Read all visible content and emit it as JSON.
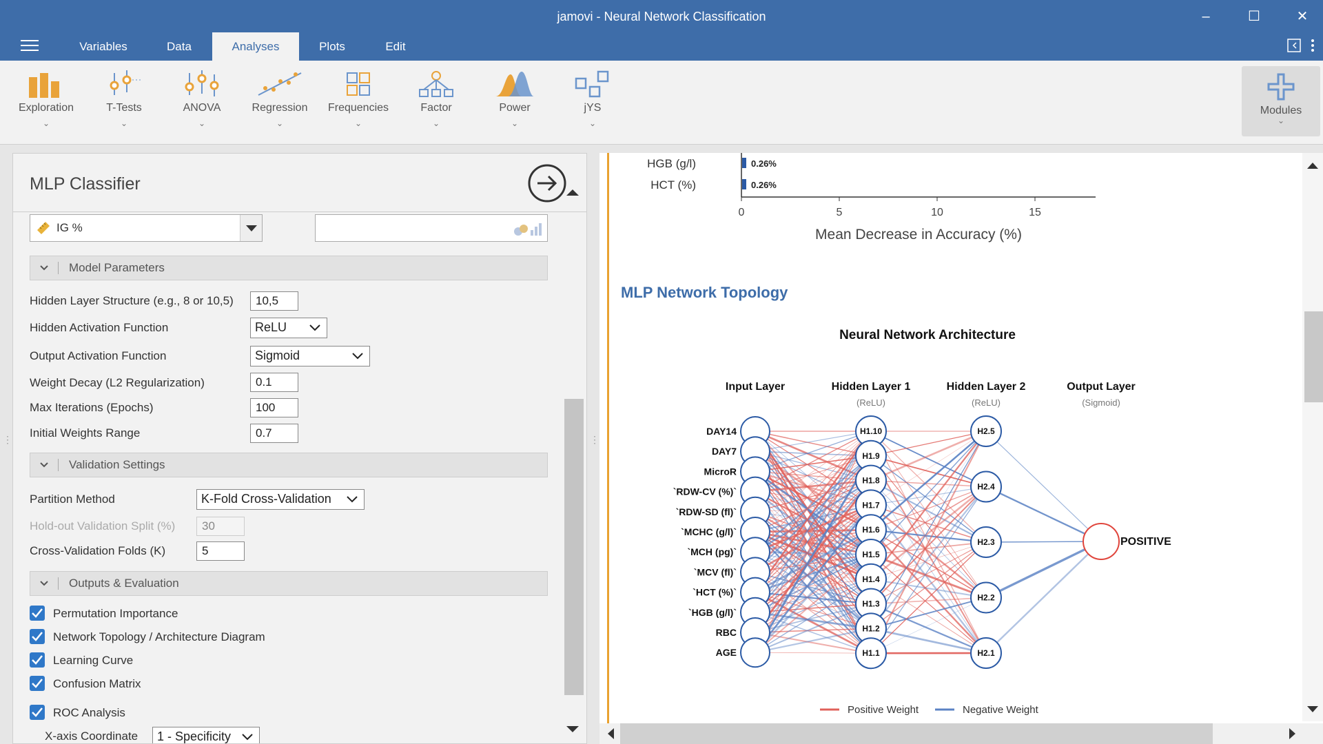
{
  "window": {
    "title": "jamovi - Neural Network Classification"
  },
  "menu": {
    "tabs": [
      "Variables",
      "Data",
      "Analyses",
      "Plots",
      "Edit"
    ],
    "active": "Analyses"
  },
  "ribbon": {
    "items": [
      "Exploration",
      "T-Tests",
      "ANOVA",
      "Regression",
      "Frequencies",
      "Factor",
      "Power",
      "jYS"
    ],
    "modules": "Modules"
  },
  "panel": {
    "title": "MLP Classifier",
    "target_variable": "IG %",
    "sections": {
      "model": "Model Parameters",
      "validation": "Validation Settings",
      "outputs": "Outputs & Evaluation"
    },
    "model": {
      "hidden_structure_label": "Hidden Layer Structure (e.g., 8 or 10,5)",
      "hidden_structure_value": "10,5",
      "hidden_activation_label": "Hidden Activation Function",
      "hidden_activation_value": "ReLU",
      "output_activation_label": "Output Activation Function",
      "output_activation_value": "Sigmoid",
      "weight_decay_label": "Weight Decay (L2 Regularization)",
      "weight_decay_value": "0.1",
      "max_iter_label": "Max Iterations (Epochs)",
      "max_iter_value": "100",
      "init_weights_label": "Initial Weights Range",
      "init_weights_value": "0.7"
    },
    "validation": {
      "partition_label": "Partition Method",
      "partition_value": "K-Fold Cross-Validation",
      "holdout_label": "Hold-out Validation Split (%)",
      "holdout_value": "30",
      "folds_label": "Cross-Validation Folds (K)",
      "folds_value": "5"
    },
    "outputs": {
      "checks": [
        "Permutation Importance",
        "Network Topology / Architecture Diagram",
        "Learning Curve",
        "Confusion Matrix",
        "ROC Analysis"
      ],
      "xaxis_label": "X-axis Coordinate",
      "xaxis_value": "1 - Specificity"
    }
  },
  "importance": {
    "rows": [
      {
        "name": "HGB (g/l)",
        "value": "0.26%"
      },
      {
        "name": "HCT (%)",
        "value": "0.26%"
      }
    ],
    "ticks": [
      "0",
      "5",
      "10",
      "15"
    ],
    "xlabel": "Mean Decrease in Accuracy (%)"
  },
  "results": {
    "heading": "MLP Network Topology"
  },
  "chart_data": {
    "type": "diagram",
    "title": "Neural Network Architecture",
    "layers": [
      {
        "name": "Input Layer",
        "sub": "",
        "nodes": [
          "DAY14",
          "DAY7",
          "MicroR",
          "`RDW-CV (%)`",
          "`RDW-SD (fl)`",
          "`MCHC (g/l)`",
          "`MCH (pg)`",
          "`MCV (fl)`",
          "`HCT (%)`",
          "`HGB (g/l)`",
          "RBC",
          "AGE"
        ]
      },
      {
        "name": "Hidden Layer 1",
        "sub": "(ReLU)",
        "nodes": [
          "H1.10",
          "H1.9",
          "H1.8",
          "H1.7",
          "H1.6",
          "H1.5",
          "H1.4",
          "H1.3",
          "H1.2",
          "H1.1"
        ]
      },
      {
        "name": "Hidden Layer 2",
        "sub": "(ReLU)",
        "nodes": [
          "H2.5",
          "H2.4",
          "H2.3",
          "H2.2",
          "H2.1"
        ]
      },
      {
        "name": "Output Layer",
        "sub": "(Sigmoid)",
        "nodes": [
          "POSITIVE"
        ]
      }
    ],
    "legend": [
      {
        "name": "Positive Weight",
        "color": "#e0605a"
      },
      {
        "name": "Negative Weight",
        "color": "#5b82c4"
      }
    ]
  }
}
